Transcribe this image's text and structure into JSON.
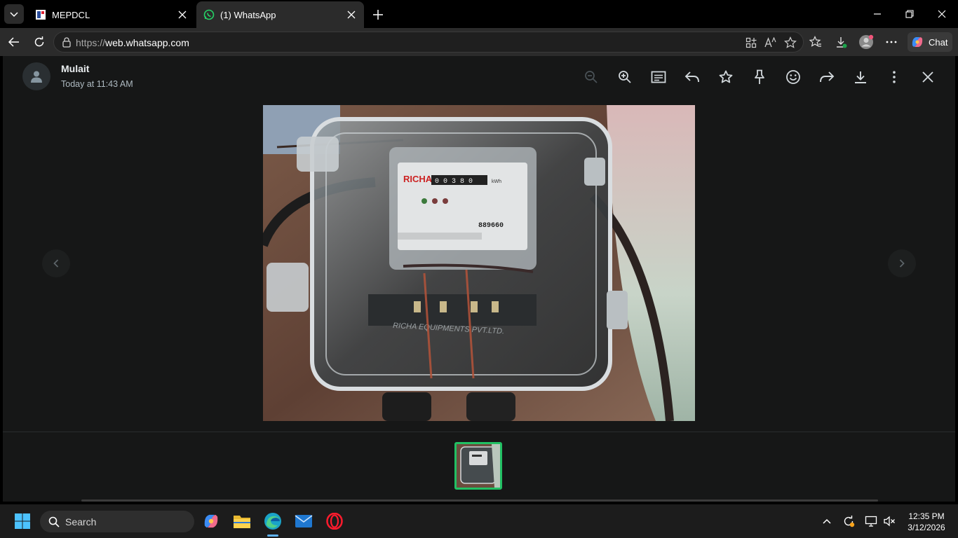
{
  "browser": {
    "tabs": [
      {
        "title": "MEPDCL",
        "active": false
      },
      {
        "title": "(1) WhatsApp",
        "active": true
      }
    ],
    "address": {
      "scheme": "https://",
      "host": "web.whatsapp.com"
    },
    "chat_label": "Chat"
  },
  "viewer": {
    "sender_name": "Mulait",
    "timestamp": "Today at 11:43 AM",
    "toolbar_icons": [
      "zoom-out-icon",
      "zoom-in-icon",
      "caption-icon",
      "reply-icon",
      "star-icon",
      "pin-icon",
      "emoji-icon",
      "forward-icon",
      "download-icon",
      "more-icon",
      "close-icon"
    ],
    "photo": {
      "meter_brand": "RICHA",
      "meter_reading": "0 0 3 8 0",
      "meter_unit": "kWh",
      "meter_serial": "889660",
      "box_text": "RICHA EQUIPMENTS PVT.LTD."
    },
    "thumbnail_count": 1,
    "accent_color": "#21c063"
  },
  "taskbar": {
    "search_label": "Search",
    "time": "12:35 PM",
    "date": "3/12/2026"
  }
}
